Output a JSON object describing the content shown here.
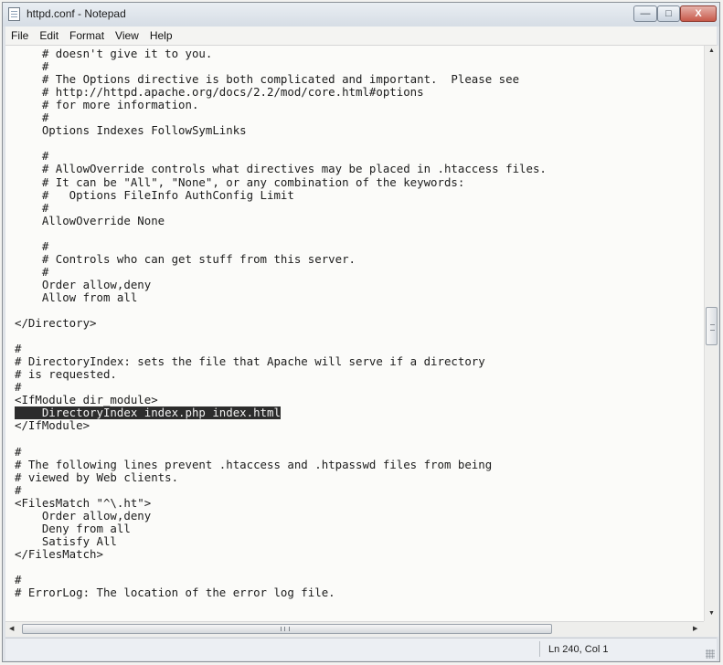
{
  "window": {
    "title": "httpd.conf - Notepad",
    "controls": {
      "minimize": "—",
      "maximize": "□",
      "close": "X"
    }
  },
  "menu": {
    "items": [
      {
        "label": "File"
      },
      {
        "label": "Edit"
      },
      {
        "label": "Format"
      },
      {
        "label": "View"
      },
      {
        "label": "Help"
      }
    ]
  },
  "editor": {
    "lines": [
      "    # doesn't give it to you.",
      "    #",
      "    # The Options directive is both complicated and important.  Please see",
      "    # http://httpd.apache.org/docs/2.2/mod/core.html#options",
      "    # for more information.",
      "    #",
      "    Options Indexes FollowSymLinks",
      "",
      "    #",
      "    # AllowOverride controls what directives may be placed in .htaccess files.",
      "    # It can be \"All\", \"None\", or any combination of the keywords:",
      "    #   Options FileInfo AuthConfig Limit",
      "    #",
      "    AllowOverride None",
      "",
      "    #",
      "    # Controls who can get stuff from this server.",
      "    #",
      "    Order allow,deny",
      "    Allow from all",
      "",
      "</Directory>",
      "",
      "#",
      "# DirectoryIndex: sets the file that Apache will serve if a directory",
      "# is requested.",
      "#",
      "<IfModule dir_module>",
      "    DirectoryIndex index.php index.html",
      "</IfModule>",
      "",
      "#",
      "# The following lines prevent .htaccess and .htpasswd files from being",
      "# viewed by Web clients.",
      "#",
      "<FilesMatch \"^\\.ht\">",
      "    Order allow,deny",
      "    Deny from all",
      "    Satisfy All",
      "</FilesMatch>",
      "",
      "#",
      "# ErrorLog: The location of the error log file."
    ],
    "selected_line_index": 28
  },
  "scrollbars": {
    "up_arrow": "▲",
    "down_arrow": "▼",
    "left_arrow": "◀",
    "right_arrow": "▶"
  },
  "statusbar": {
    "position": "Ln 240, Col 1"
  }
}
